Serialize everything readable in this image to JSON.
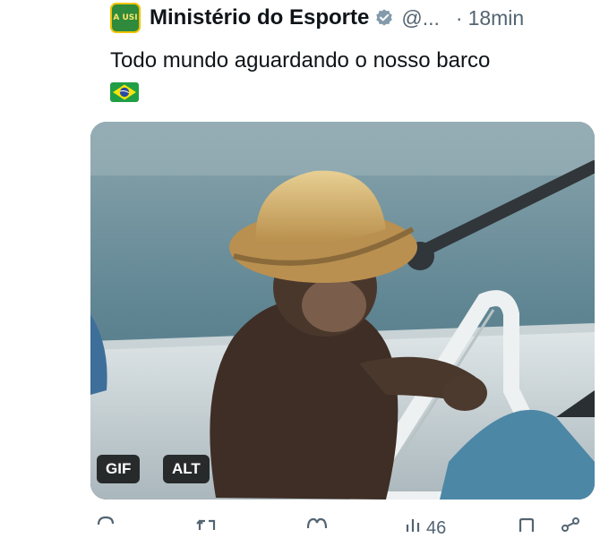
{
  "post": {
    "author_name": "Ministério do Esporte",
    "avatar_text": "A USI",
    "handle": "@...",
    "separator": "·",
    "time": "18min",
    "text": "Todo mundo aguardando o nosso barco",
    "verified": true
  },
  "media": {
    "gif_label": "GIF",
    "alt_label": "ALT"
  },
  "actions": {
    "views": "46"
  },
  "icons": {
    "verified": "verified-badge-icon",
    "flag": "brazil-flag-emoji",
    "reply": "reply-icon",
    "repost": "repost-icon",
    "like": "like-icon",
    "views": "views-icon",
    "bookmark": "bookmark-icon",
    "share": "share-icon"
  },
  "colors": {
    "text": "#0f1419",
    "secondary": "#536471",
    "avatar_green": "#2f8a3b",
    "avatar_yellow": "#f2c200",
    "verified_gray": "#829aab"
  }
}
